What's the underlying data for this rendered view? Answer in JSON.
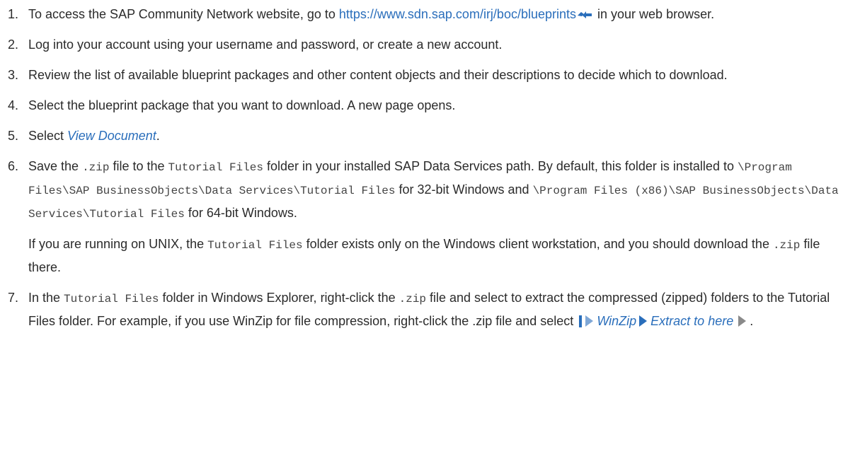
{
  "steps": [
    {
      "number": "1.",
      "before": "To access the SAP Community Network website, go to ",
      "link": "https://www.sdn.sap.com/irj/boc/blueprints",
      "after": " in your web browser."
    },
    {
      "number": "2.",
      "text": "Log into your account using your username and password, or create a new account."
    },
    {
      "number": "3.",
      "text": "Review the list of available blueprint packages and other content objects and their descriptions to decide which to download."
    },
    {
      "number": "4.",
      "text": "Select the blueprint package that you want to download. A new page opens."
    },
    {
      "number": "5.",
      "before": "Select ",
      "ui": "View Document",
      "after": "."
    },
    {
      "number": "6.",
      "t1": "Save the ",
      "c1": ".zip",
      "t2": " file to the ",
      "c2": "Tutorial Files",
      "t3": " folder in your installed SAP Data Services path. By default, this folder is installed to ",
      "c3": "\\Program Files\\SAP BusinessObjects\\Data Services\\Tutorial Files",
      "t4": " for 32-bit Windows and ",
      "c4": "\\Program Files (x86)\\SAP BusinessObjects\\Data Services\\Tutorial Files",
      "t5": " for 64-bit Windows.",
      "note": {
        "t1": "If you are running on UNIX, the ",
        "c1": "Tutorial Files",
        "t2": " folder exists only on the Windows client workstation, and you should download the ",
        "c2": ".zip",
        "t3": " file there."
      }
    },
    {
      "number": "7.",
      "t1": "In the ",
      "c1": "Tutorial Files",
      "t2": " folder in Windows Explorer, right-click the ",
      "c2": ".zip",
      "t3": " file and select to extract the compressed (zipped) folders to the Tutorial Files folder. For example, if you use WinZip for file compression, right-click the .zip file and select ",
      "menu1": "WinZip",
      "menu2": "Extract to here",
      "t4": "."
    }
  ]
}
